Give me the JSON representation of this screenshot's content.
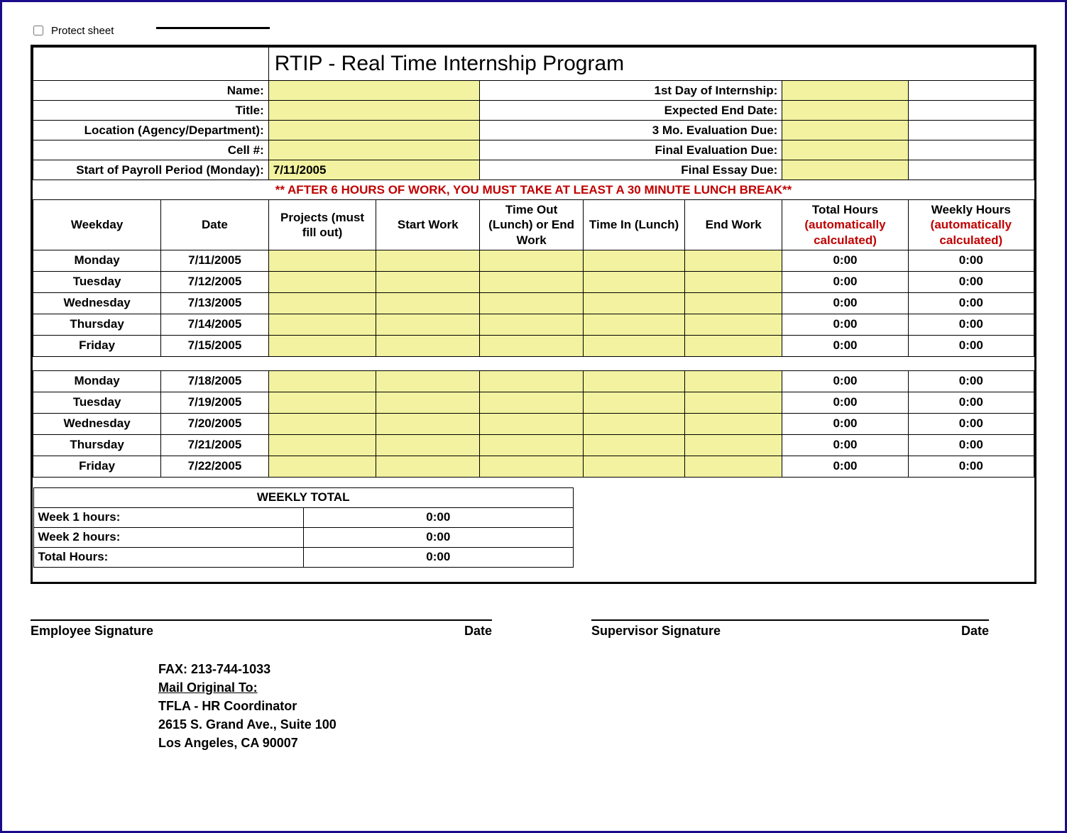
{
  "protect_sheet_label": "Protect sheet",
  "title": "RTIP - Real Time Internship Program",
  "header_labels": {
    "name": "Name:",
    "first_day": "1st Day of Internship:",
    "title_lbl": "Title:",
    "expected_end": "Expected End Date:",
    "location": "Location (Agency/Department):",
    "eval3mo": "3 Mo. Evaluation Due:",
    "cell": "Cell #:",
    "final_eval": "Final Evaluation Due:",
    "payroll_start": "Start of Payroll Period (Monday):",
    "final_essay": "Final Essay Due:"
  },
  "header_values": {
    "payroll_start": "7/11/2005"
  },
  "lunch_note": "** AFTER 6 HOURS OF WORK, YOU MUST TAKE AT LEAST A 30 MINUTE LUNCH BREAK**",
  "columns": {
    "weekday": "Weekday",
    "date": "Date",
    "projects": "Projects (must fill out)",
    "start_work": "Start Work",
    "time_out": "Time Out (Lunch) or End Work",
    "time_in": "Time In (Lunch)",
    "end_work": "End Work",
    "total_hours_a": "Total Hours",
    "total_hours_b": "(automatically calculated)",
    "weekly_hours_a": "Weekly Hours",
    "weekly_hours_b": "(automatically calculated)"
  },
  "rows": [
    {
      "weekday": "Monday",
      "date": "7/11/2005",
      "total": "0:00",
      "weekly": "0:00"
    },
    {
      "weekday": "Tuesday",
      "date": "7/12/2005",
      "total": "0:00",
      "weekly": "0:00"
    },
    {
      "weekday": "Wednesday",
      "date": "7/13/2005",
      "total": "0:00",
      "weekly": "0:00"
    },
    {
      "weekday": "Thursday",
      "date": "7/14/2005",
      "total": "0:00",
      "weekly": "0:00"
    },
    {
      "weekday": "Friday",
      "date": "7/15/2005",
      "total": "0:00",
      "weekly": "0:00"
    },
    {
      "weekday": "Monday",
      "date": "7/18/2005",
      "total": "0:00",
      "weekly": "0:00"
    },
    {
      "weekday": "Tuesday",
      "date": "7/19/2005",
      "total": "0:00",
      "weekly": "0:00"
    },
    {
      "weekday": "Wednesday",
      "date": "7/20/2005",
      "total": "0:00",
      "weekly": "0:00"
    },
    {
      "weekday": "Thursday",
      "date": "7/21/2005",
      "total": "0:00",
      "weekly": "0:00"
    },
    {
      "weekday": "Friday",
      "date": "7/22/2005",
      "total": "0:00",
      "weekly": "0:00"
    }
  ],
  "weekly_total": {
    "heading": "WEEKLY TOTAL",
    "week1_label": "Week 1 hours:",
    "week1_value": "0:00",
    "week2_label": "Week 2 hours:",
    "week2_value": "0:00",
    "total_label": "Total Hours:",
    "total_value": "0:00"
  },
  "signatures": {
    "employee": "Employee Signature",
    "supervisor": "Supervisor Signature",
    "date": "Date"
  },
  "footer": {
    "fax": "FAX:  213-744-1033",
    "mail_heading": "Mail Original To:",
    "line1": "TFLA - HR Coordinator",
    "line2": "2615 S. Grand Ave., Suite 100",
    "line3": "Los Angeles, CA 90007"
  }
}
